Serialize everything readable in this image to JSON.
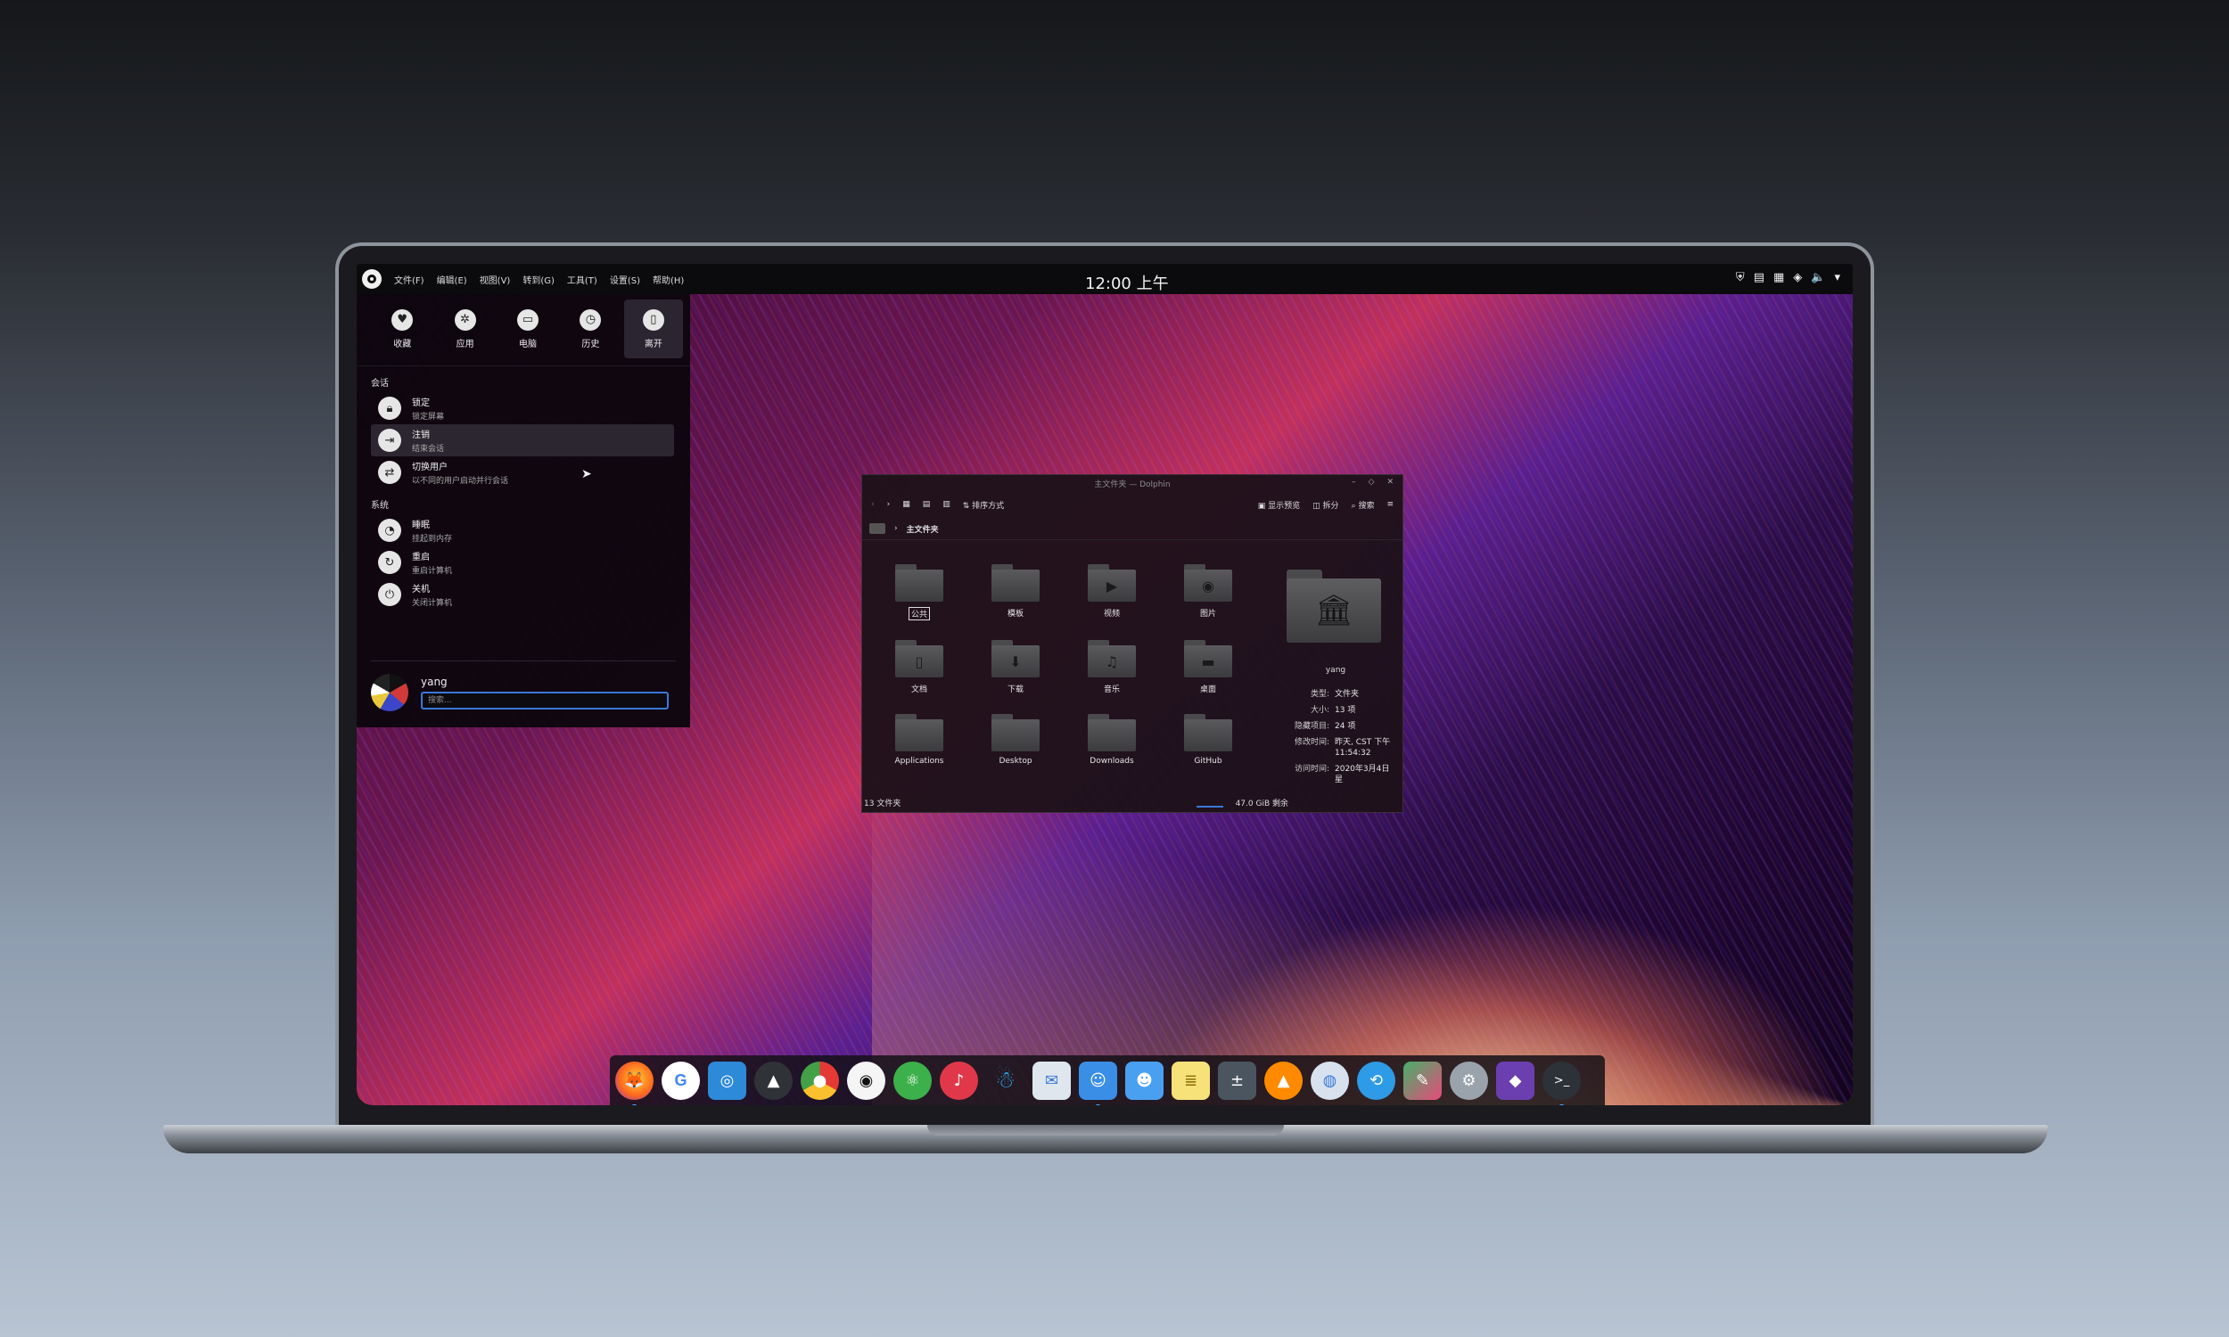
{
  "topbar": {
    "menus": [
      "文件(F)",
      "编辑(E)",
      "视图(V)",
      "转到(G)",
      "工具(T)",
      "设置(S)",
      "帮助(H)"
    ],
    "clock": "12:00 上午",
    "tray_icons": [
      "shield-icon",
      "clipboard-icon",
      "network-icon",
      "system-monitor-icon",
      "volume-icon",
      "menu-arrow-icon"
    ]
  },
  "launcher": {
    "tabs": [
      {
        "label": "收藏",
        "icon": "heart-icon"
      },
      {
        "label": "应用",
        "icon": "apps-icon"
      },
      {
        "label": "电脑",
        "icon": "computer-icon"
      },
      {
        "label": "历史",
        "icon": "history-icon"
      },
      {
        "label": "离开",
        "icon": "leave-icon"
      }
    ],
    "session_title": "会话",
    "session_items": [
      {
        "title": "锁定",
        "subtitle": "锁定屏幕",
        "icon": "lock-icon"
      },
      {
        "title": "注销",
        "subtitle": "结束会话",
        "icon": "logout-icon"
      },
      {
        "title": "切换用户",
        "subtitle": "以不同的用户启动并行会话",
        "icon": "switch-user-icon"
      }
    ],
    "system_title": "系统",
    "system_items": [
      {
        "title": "睡眠",
        "subtitle": "挂起到内存",
        "icon": "sleep-icon"
      },
      {
        "title": "重启",
        "subtitle": "重启计算机",
        "icon": "restart-icon"
      },
      {
        "title": "关机",
        "subtitle": "关闭计算机",
        "icon": "power-icon"
      }
    ],
    "user_name": "yang",
    "search_placeholder": "搜索..."
  },
  "dolphin": {
    "title": "主文件夹 — Dolphin",
    "toolbar": {
      "sort": "排序方式",
      "preview": "显示预览",
      "split": "拆分",
      "search": "搜索"
    },
    "path": "主文件夹",
    "files": [
      {
        "name": "公共",
        "icon": "folder-public-icon"
      },
      {
        "name": "模板",
        "icon": "folder-templates-icon"
      },
      {
        "name": "视频",
        "icon": "folder-videos-icon"
      },
      {
        "name": "图片",
        "icon": "folder-pictures-icon"
      },
      {
        "name": "文档",
        "icon": "folder-documents-icon"
      },
      {
        "name": "下载",
        "icon": "folder-downloads-icon"
      },
      {
        "name": "音乐",
        "icon": "folder-music-icon"
      },
      {
        "name": "桌面",
        "icon": "folder-desktop-icon"
      },
      {
        "name": "Applications",
        "icon": "folder-icon"
      },
      {
        "name": "Desktop",
        "icon": "folder-icon"
      },
      {
        "name": "Downloads",
        "icon": "folder-icon"
      },
      {
        "name": "GitHub",
        "icon": "folder-icon"
      }
    ],
    "info": {
      "owner": "yang",
      "rows": [
        {
          "k": "类型:",
          "v": "文件夹"
        },
        {
          "k": "大小:",
          "v": "13 项"
        },
        {
          "k": "隐藏项目:",
          "v": "24 项"
        },
        {
          "k": "修改时间:",
          "v": "昨天, CST 下午 11:54:32"
        },
        {
          "k": "访问时间:",
          "v": "2020年3月4日星"
        }
      ]
    },
    "status_left": "13 文件夹",
    "status_right": "47.0 GiB 剩余"
  },
  "dock": {
    "apps": [
      {
        "name": "firefox-icon",
        "color": "#ff7b1c"
      },
      {
        "name": "google-chrome-icon",
        "color": "#ffffff"
      },
      {
        "name": "screenshot-icon",
        "color": "#2d8ad8"
      },
      {
        "name": "inkscape-icon",
        "color": "#2f3338"
      },
      {
        "name": "chromium-icon",
        "color": "#3d7be0"
      },
      {
        "name": "github-icon",
        "color": "#f5f5f5"
      },
      {
        "name": "atom-icon",
        "color": "#3cb04a"
      },
      {
        "name": "netease-music-icon",
        "color": "#e0384a"
      },
      {
        "name": "qq-icon",
        "color": "#2aa8e8"
      },
      {
        "name": "mail-icon",
        "color": "#dfe6ee"
      },
      {
        "name": "finder-icon",
        "color": "#3a8ee6"
      },
      {
        "name": "finder-alt-icon",
        "color": "#4aa0f0"
      },
      {
        "name": "notes-icon",
        "color": "#f7e27a"
      },
      {
        "name": "calculator-icon",
        "color": "#4a5560"
      },
      {
        "name": "vlc-icon",
        "color": "#ff8a00"
      },
      {
        "name": "browser-icon",
        "color": "#d8e2ee"
      },
      {
        "name": "share-icon",
        "color": "#2e9be6"
      },
      {
        "name": "paint-icon",
        "color": "#45b06a"
      },
      {
        "name": "settings-icon",
        "color": "#9aa3ac"
      },
      {
        "name": "kde-connect-icon",
        "color": "#6b3fb0"
      },
      {
        "name": "terminal-icon",
        "color": "#2c3238"
      }
    ]
  }
}
